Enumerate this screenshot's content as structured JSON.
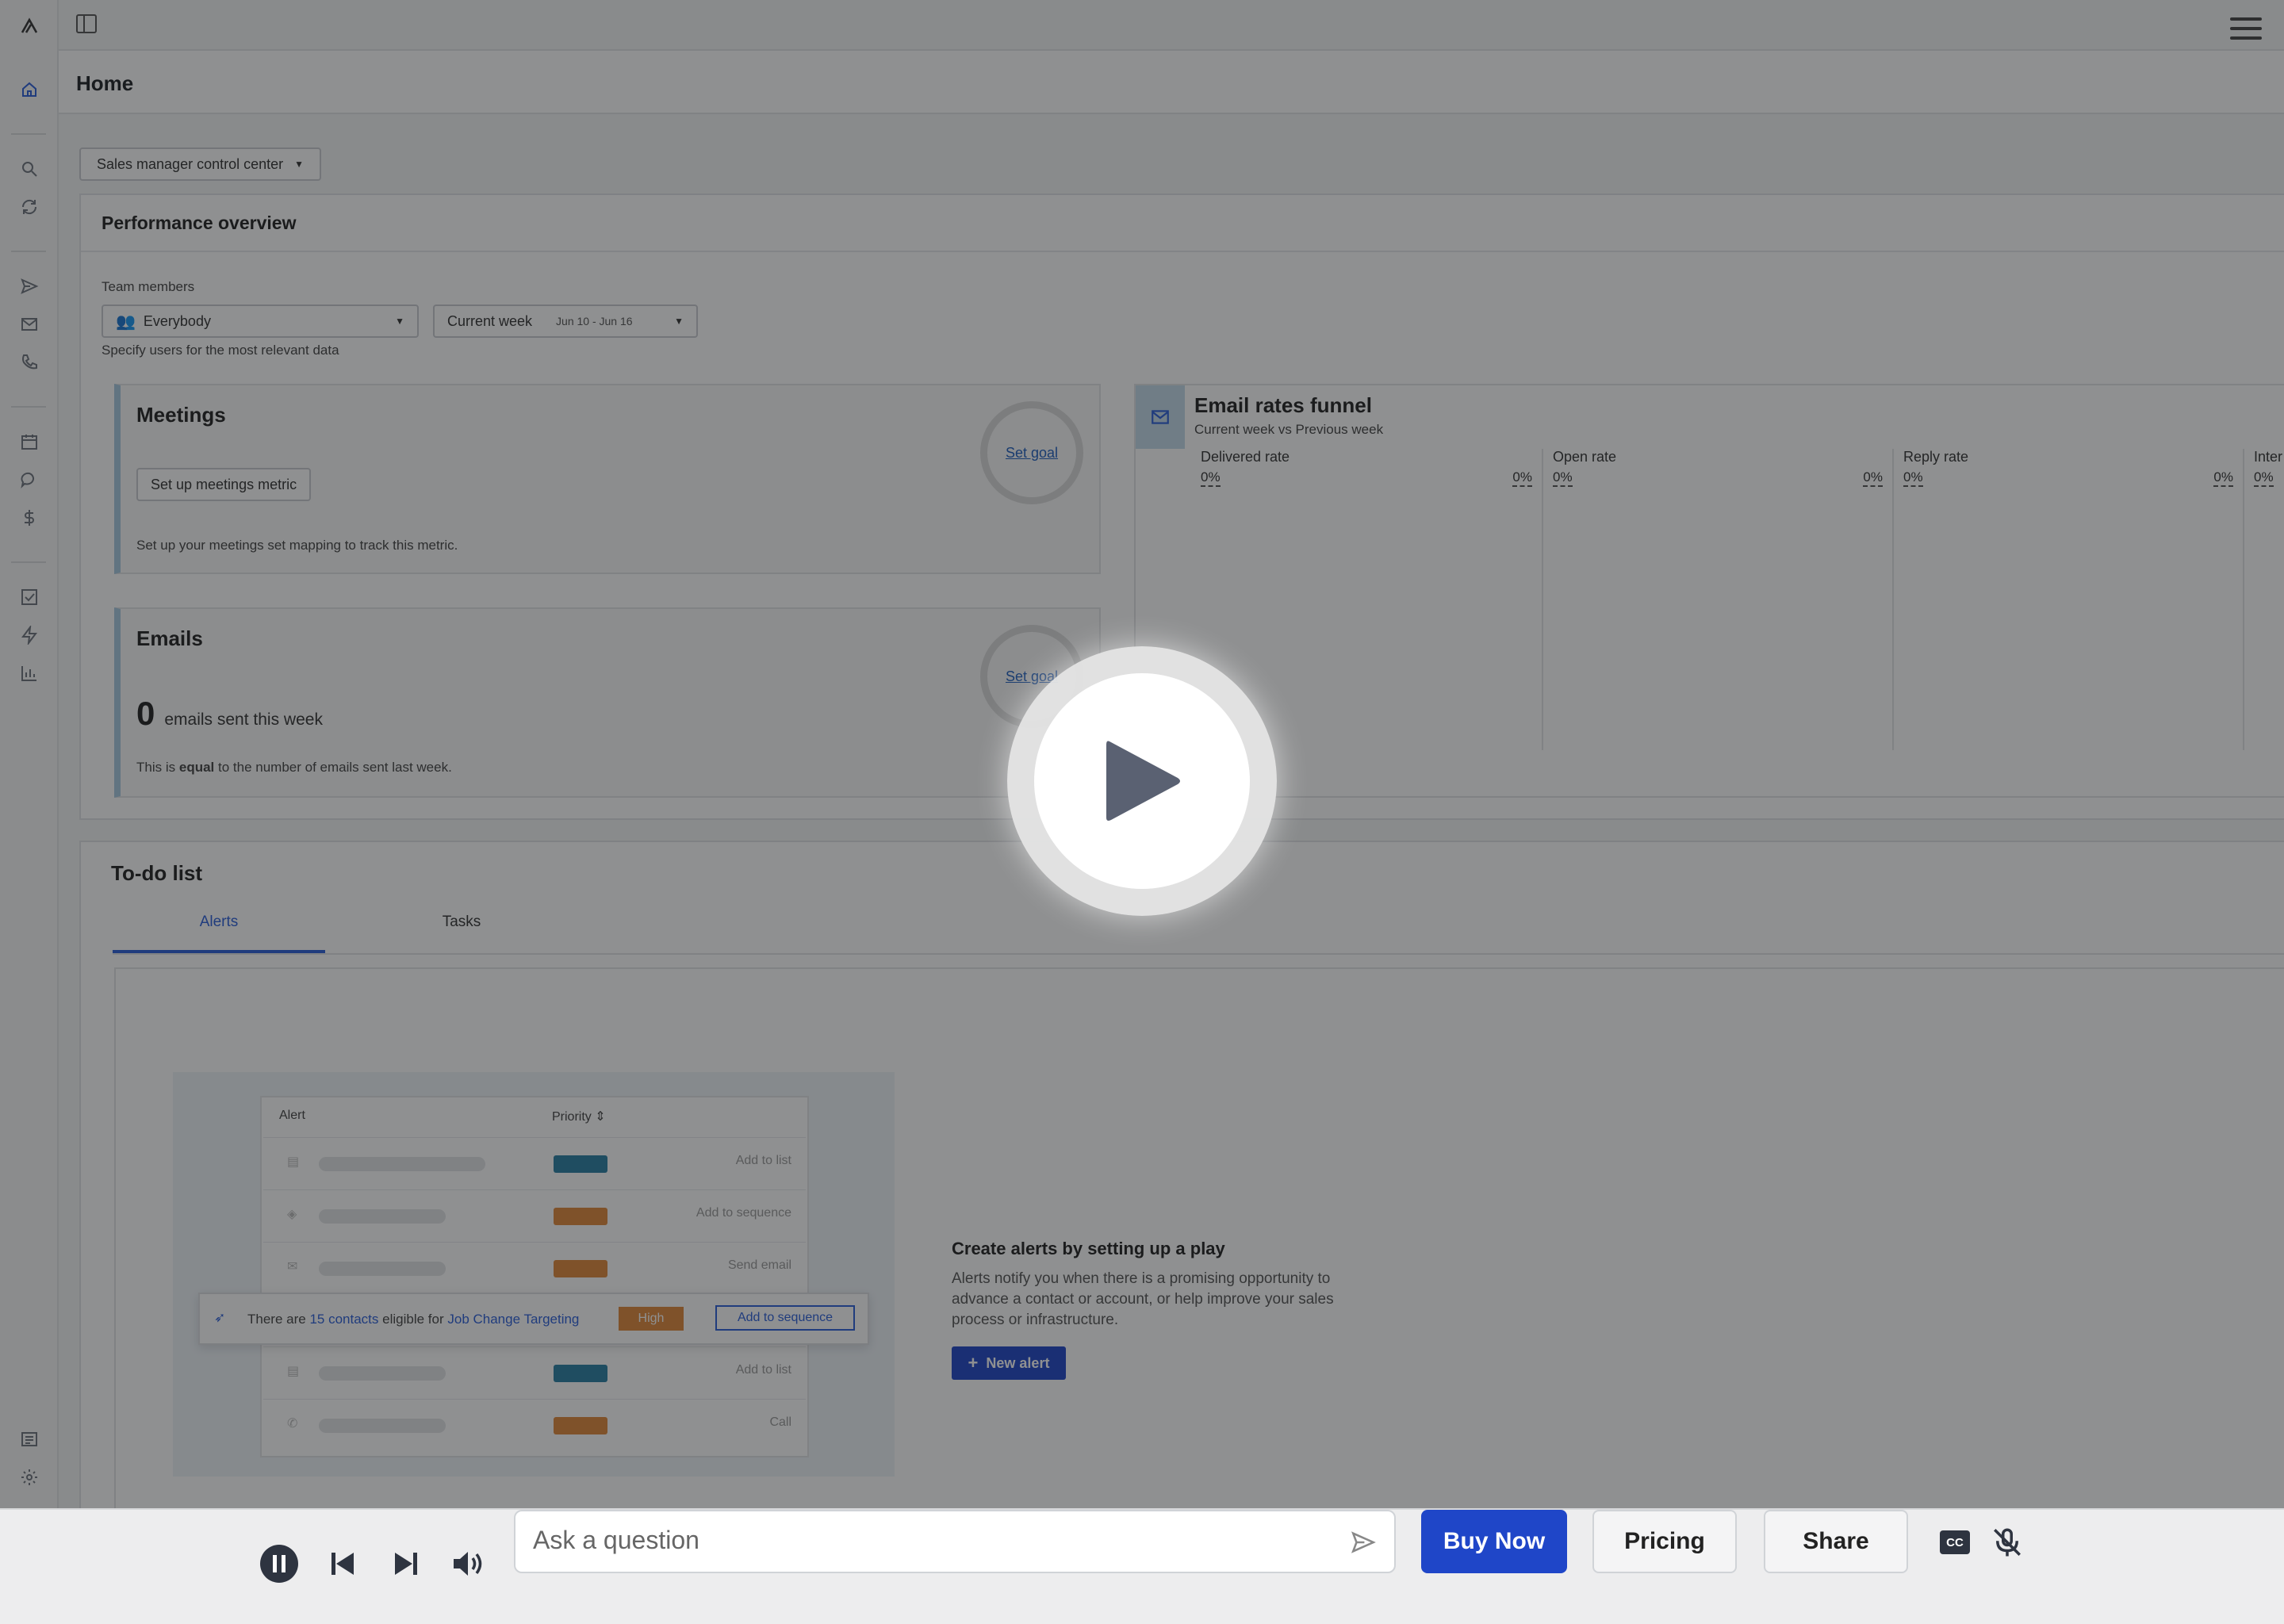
{
  "page": {
    "title": "Home"
  },
  "dashboard_select": {
    "label": "Sales manager control center"
  },
  "performance": {
    "title": "Performance overview",
    "team_label": "Team members",
    "team_value": "Everybody",
    "period_label": "Current week",
    "period_range": "Jun 10 - Jun 16",
    "hint": "Specify users for the most relevant data"
  },
  "meetings": {
    "title": "Meetings",
    "setup_button": "Set up meetings metric",
    "goal_link": "Set goal",
    "description": "Set up your meetings set mapping to track this metric."
  },
  "emails": {
    "title": "Emails",
    "goal_link": "Set goal",
    "count": "0",
    "count_label": "emails sent this week",
    "desc_prefix": "This is",
    "desc_bold": "equal",
    "desc_suffix": "to the number of emails sent last week."
  },
  "funnel": {
    "title": "Email rates funnel",
    "subtitle": "Current week vs Previous week",
    "columns": [
      {
        "label": "Delivered rate",
        "left_value": "0%",
        "right_value": "0%"
      },
      {
        "label": "Open rate",
        "left_value": "0%",
        "right_value": "0%"
      },
      {
        "label": "Reply rate",
        "left_value": "0%",
        "right_value": "0%"
      },
      {
        "label": "Inter",
        "left_value": "0%",
        "right_value": ""
      }
    ]
  },
  "todo": {
    "title": "To-do list",
    "tabs": [
      "Alerts",
      "Tasks"
    ],
    "mock": {
      "col_alert": "Alert",
      "col_priority": "Priority",
      "rows": [
        {
          "action": "Add to list",
          "color": "#2a7fa3"
        },
        {
          "action": "Add to sequence",
          "color": "#e0893a"
        },
        {
          "action": "Send email",
          "color": "#e0893a"
        },
        {
          "action": "Add to list",
          "color": "#2a7fa3"
        },
        {
          "action": "Call",
          "color": "#e0893a"
        }
      ],
      "highlight_prefix": "There are",
      "highlight_count": "15 contacts",
      "highlight_mid": "eligible for",
      "highlight_play": "Job Change Targeting",
      "highlight_priority": "High",
      "highlight_action": "Add to sequence"
    },
    "cta_title": "Create alerts by setting up a play",
    "cta_text": "Alerts notify you when there is a promising opportunity to advance a contact or account, or help improve your sales process or infrastructure.",
    "new_alert": "New alert"
  },
  "player": {
    "ask_placeholder": "Ask a question",
    "buy_now": "Buy Now",
    "pricing": "Pricing",
    "share": "Share",
    "cc": "CC"
  },
  "colors": {
    "accent": "#1f46c8",
    "brand": "#2b5fd9",
    "high": "#e0893a"
  }
}
